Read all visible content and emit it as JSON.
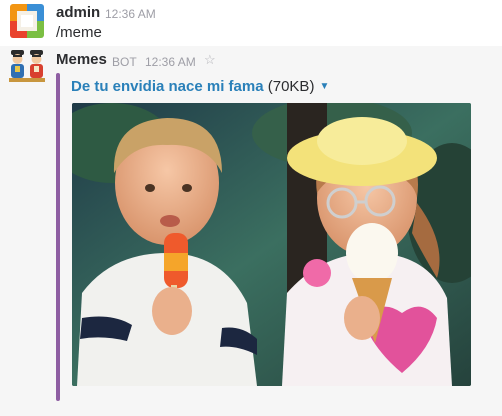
{
  "messages": [
    {
      "user": "admin",
      "time": "12:36 AM",
      "text": "/meme",
      "avatar_icon": "admin-tile-avatar-icon"
    },
    {
      "user": "Memes",
      "badge": "BOT",
      "time": "12:36 AM",
      "star_icon": "star-icon",
      "avatar_icon": "memes-bot-avatar-icon",
      "attachment": {
        "title": "De tu envidia nace mi fama",
        "size": "(70KB)",
        "dropdown_icon": "caret-down-icon",
        "image": "kids-eating-ice-cream-photo"
      }
    }
  ],
  "colors": {
    "link": "#2a80b9",
    "attachment_bar": "#8e5ea2",
    "timestamp": "#9e9ea6",
    "hover_background": "#f6f6f6"
  }
}
